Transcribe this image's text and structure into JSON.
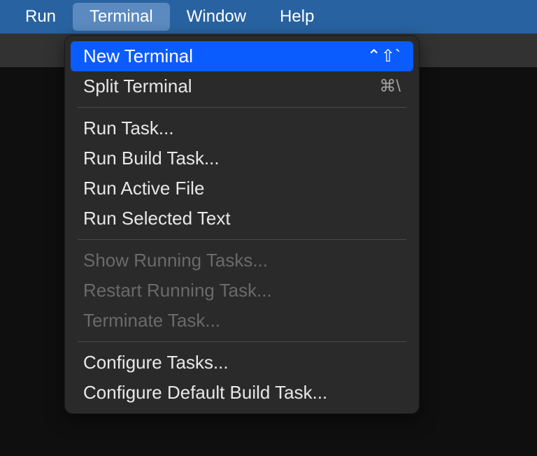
{
  "menubar": {
    "items": [
      {
        "label": "Run",
        "active": false
      },
      {
        "label": "Terminal",
        "active": true
      },
      {
        "label": "Window",
        "active": false
      },
      {
        "label": "Help",
        "active": false
      }
    ]
  },
  "dropdown": {
    "groups": [
      [
        {
          "label": "New Terminal",
          "shortcut": "⌃⇧`",
          "highlighted": true,
          "disabled": false
        },
        {
          "label": "Split Terminal",
          "shortcut": "⌘\\",
          "highlighted": false,
          "disabled": false
        }
      ],
      [
        {
          "label": "Run Task...",
          "shortcut": "",
          "highlighted": false,
          "disabled": false
        },
        {
          "label": "Run Build Task...",
          "shortcut": "",
          "highlighted": false,
          "disabled": false
        },
        {
          "label": "Run Active File",
          "shortcut": "",
          "highlighted": false,
          "disabled": false
        },
        {
          "label": "Run Selected Text",
          "shortcut": "",
          "highlighted": false,
          "disabled": false
        }
      ],
      [
        {
          "label": "Show Running Tasks...",
          "shortcut": "",
          "highlighted": false,
          "disabled": true
        },
        {
          "label": "Restart Running Task...",
          "shortcut": "",
          "highlighted": false,
          "disabled": true
        },
        {
          "label": "Terminate Task...",
          "shortcut": "",
          "highlighted": false,
          "disabled": true
        }
      ],
      [
        {
          "label": "Configure Tasks...",
          "shortcut": "",
          "highlighted": false,
          "disabled": false
        },
        {
          "label": "Configure Default Build Task...",
          "shortcut": "",
          "highlighted": false,
          "disabled": false
        }
      ]
    ]
  }
}
